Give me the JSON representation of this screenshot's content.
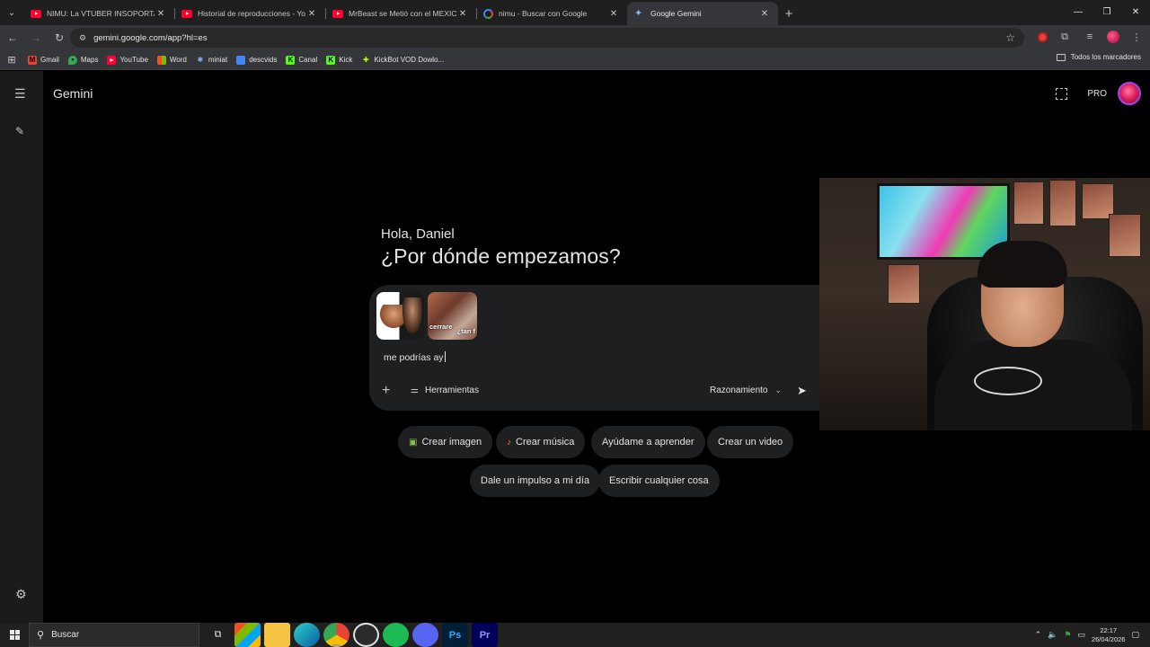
{
  "browser": {
    "tabs": [
      {
        "title": "NIMU: La VTUBER INSOPORTABLE",
        "favicon": "youtube-icon",
        "active": false
      },
      {
        "title": "Historial de reproducciones - YouTube",
        "favicon": "youtube-icon",
        "active": false
      },
      {
        "title": "MrBeast se Metió con el MEXICANO",
        "favicon": "youtube-icon",
        "active": false
      },
      {
        "title": "nimu - Buscar con Google",
        "favicon": "google-icon",
        "active": false
      },
      {
        "title": "Google Gemini",
        "favicon": "gemini-icon",
        "active": true
      }
    ],
    "url": "gemini.google.com/app?hl=es",
    "bookmarks": [
      {
        "label": "Gmail",
        "icon": "gmail-icon",
        "color": "#ea4335"
      },
      {
        "label": "Maps",
        "icon": "maps-icon",
        "color": "#34a853"
      },
      {
        "label": "YouTube",
        "icon": "youtube-icon",
        "color": "#ff0033"
      },
      {
        "label": "Word",
        "icon": "word-icon",
        "color": "#4285f4"
      },
      {
        "label": "miniat",
        "icon": "miniat-icon",
        "color": "#8ab4f8"
      },
      {
        "label": "descvids",
        "icon": "descvids-icon",
        "color": "#4285f4"
      },
      {
        "label": "Canal",
        "icon": "canal-icon",
        "color": "#53fc18"
      },
      {
        "label": "Kick",
        "icon": "kick-icon",
        "color": "#53fc18"
      },
      {
        "label": "KickBot VOD Dowlo...",
        "icon": "kickbot-icon",
        "color": "#c6ff00"
      }
    ],
    "all_bookmarks": "Todos los marcadores"
  },
  "app": {
    "brand": "Gemini",
    "plan": "PRO",
    "greeting": "Hola, Daniel",
    "headline": "¿Por dónde empezamos?",
    "composer": {
      "value": "me podrías ay",
      "tools_label": "Herramientas",
      "mode_label": "Razonamiento",
      "thumb1_label": "",
      "thumb2_text1": "cerrare",
      "thumb2_text2": "¿tan f"
    },
    "chips": [
      {
        "label": "Crear imagen",
        "icon": "image-icon"
      },
      {
        "label": "Crear música",
        "icon": "music-icon"
      },
      {
        "label": "Ayúdame a aprender",
        "icon": ""
      },
      {
        "label": "Crear un video",
        "icon": ""
      },
      {
        "label": "Dale un impulso a mi día",
        "icon": ""
      },
      {
        "label": "Escribir cualquier cosa",
        "icon": ""
      }
    ]
  },
  "taskbar": {
    "search_placeholder": "Buscar",
    "time": "22:17",
    "date": "26/04/2026"
  }
}
